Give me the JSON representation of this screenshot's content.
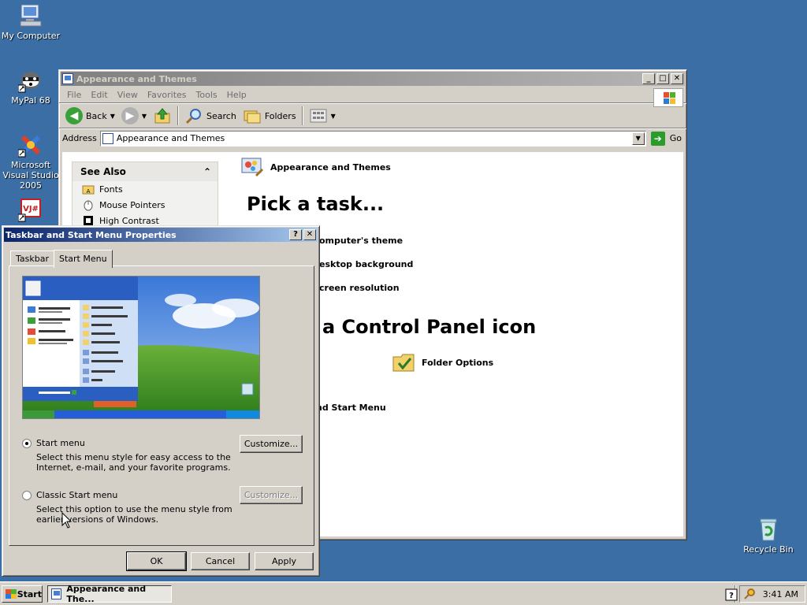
{
  "desktop": {
    "icons": [
      {
        "label": "My Computer"
      },
      {
        "label": "MyPal 68"
      },
      {
        "label": "Microsoft Visual Studio 2005"
      },
      {
        "label": "VJ#"
      },
      {
        "label": "Recycle Bin"
      }
    ],
    "background_color": "#3a6ea5"
  },
  "explorer": {
    "title": "Appearance and Themes",
    "menu": [
      "File",
      "Edit",
      "View",
      "Favorites",
      "Tools",
      "Help"
    ],
    "toolbar": {
      "back": "Back",
      "search": "Search",
      "folders": "Folders"
    },
    "address": {
      "label": "Address",
      "value": "Appearance and Themes",
      "go": "Go"
    },
    "see_also": {
      "title": "See Also",
      "items": [
        "Fonts",
        "Mouse Pointers",
        "High Contrast"
      ]
    },
    "category_title": "Appearance and Themes",
    "pick_task": "Pick a task...",
    "tasks": [
      "omputer's theme",
      "esktop background",
      "creen resolution"
    ],
    "pick_icon": "a Control Panel icon",
    "icons": [
      "Folder Options",
      "nd Start Menu"
    ]
  },
  "dialog": {
    "title": "Taskbar and Start Menu Properties",
    "tabs": [
      "Taskbar",
      "Start Menu"
    ],
    "start_menu": {
      "label": "Start menu",
      "desc_line1": "Select this menu style for easy access to the",
      "desc_line2": "Internet, e-mail, and your favorite programs.",
      "customize": "Customize..."
    },
    "classic_menu": {
      "label": "Classic Start menu",
      "desc_line1": "Select this option to use the menu style from",
      "desc_line2": "earlier versions of Windows.",
      "customize": "Customize..."
    },
    "buttons": {
      "ok": "OK",
      "cancel": "Cancel",
      "apply": "Apply"
    }
  },
  "taskbar": {
    "start": "Start",
    "task": "Appearance and The...",
    "clock": "3:41 AM"
  }
}
